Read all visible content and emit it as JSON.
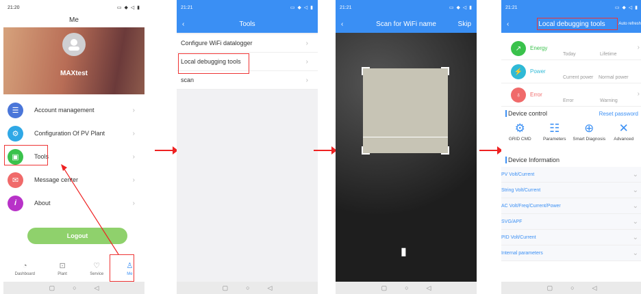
{
  "p1": {
    "time": "21:20",
    "title": "Me",
    "username": "MAXtest",
    "menu": [
      {
        "label": "Account management",
        "icon": "account-icon",
        "color": "#4a76d9"
      },
      {
        "label": "Configuration Of PV Plant",
        "icon": "config-icon",
        "color": "#2fa8e6"
      },
      {
        "label": "Tools",
        "icon": "toolbox-icon",
        "color": "#3ac24c"
      },
      {
        "label": "Message center",
        "icon": "message-icon",
        "color": "#f06a6a"
      },
      {
        "label": "About",
        "icon": "info-icon",
        "color": "#b832c8"
      }
    ],
    "logout": "Logout",
    "tabs": [
      {
        "label": "Dashboard",
        "icon": "dashboard-icon"
      },
      {
        "label": "Plant",
        "icon": "plant-icon"
      },
      {
        "label": "Service",
        "icon": "service-icon"
      },
      {
        "label": "Me",
        "icon": "person-icon"
      }
    ]
  },
  "p2": {
    "time": "21:21",
    "title": "Tools",
    "items": [
      "Configure WiFi datalogger",
      "Local debugging tools",
      "scan"
    ]
  },
  "p3": {
    "time": "21:21",
    "title": "Scan for WiFi name",
    "skip": "Skip"
  },
  "p4": {
    "time": "21:21",
    "title": "Local debugging tools",
    "refresh": "Auto refresh",
    "energy": {
      "label": "Energy",
      "today": "Today",
      "lifetime": "Lifetime"
    },
    "power": {
      "label": "Power",
      "current": "Current power",
      "normal": "Normal power"
    },
    "error": {
      "label": "Error",
      "error": "Error",
      "warning": "Warning"
    },
    "device_control": "Device control",
    "reset": "Reset password",
    "controls": [
      "GRID CMD",
      "Parameters",
      "Smart Diagnosis",
      "Advanced"
    ],
    "device_info": "Device Information",
    "info_rows": [
      "PV Volt/Current",
      "String Volt/Current",
      "AC Volt/Freq/Current/Power",
      "SVG/APF",
      "PID Volt/Current",
      "Internal parameters"
    ]
  },
  "colors": {
    "accent": "#3a8ff4",
    "highlight": "#e33333",
    "logout": "#8fd16c"
  }
}
